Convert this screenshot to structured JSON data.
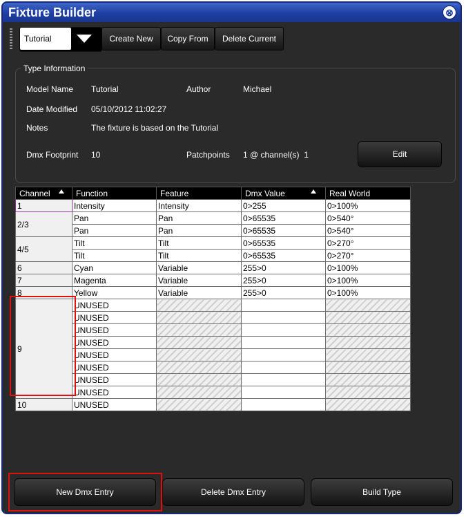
{
  "window": {
    "title": "Fixture Builder",
    "close_glyph": "⊗"
  },
  "toolbar": {
    "type_select_value": "Tutorial",
    "buttons": [
      "Create New",
      "Copy From",
      "Delete Current"
    ]
  },
  "type_info": {
    "legend": "Type Information",
    "model_name_label": "Model Name",
    "model_name": "Tutorial",
    "author_label": "Author",
    "author": "Michael",
    "date_label": "Date Modified",
    "date": "05/10/2012 11:02:27",
    "notes_label": "Notes",
    "notes": "The fixture is based on the Tutorial",
    "footprint_label": "Dmx Footprint",
    "footprint": "10",
    "patchpoints_label": "Patchpoints",
    "patchpoints": "1 @ channel(s)  1",
    "edit_label": "Edit"
  },
  "grid": {
    "headers": [
      "Channel",
      "Function",
      "Feature",
      "Dmx Value",
      "Real World"
    ],
    "rows": [
      {
        "channel": "1",
        "function": "Intensity",
        "feature": "Intensity",
        "dmx": "0>255",
        "real": "0>100%"
      },
      {
        "channel": "2/3",
        "function": "Pan",
        "feature": "Pan",
        "dmx": "0>65535",
        "real": "0>540°"
      },
      {
        "channel": "",
        "function": "Pan",
        "feature": "Pan",
        "dmx": "0>65535",
        "real": "0>540°"
      },
      {
        "channel": "4/5",
        "function": "Tilt",
        "feature": "Tilt",
        "dmx": "0>65535",
        "real": "0>270°"
      },
      {
        "channel": "",
        "function": "Tilt",
        "feature": "Tilt",
        "dmx": "0>65535",
        "real": "0>270°"
      },
      {
        "channel": "6",
        "function": "Cyan",
        "feature": "Variable",
        "dmx": "255>0",
        "real": "0>100%"
      },
      {
        "channel": "7",
        "function": "Magenta",
        "feature": "Variable",
        "dmx": "255>0",
        "real": "0>100%"
      },
      {
        "channel": "8",
        "function": "Yellow",
        "feature": "Variable",
        "dmx": "255>0",
        "real": "0>100%"
      },
      {
        "channel": "9",
        "function": "UNUSED",
        "feature": "",
        "dmx": "",
        "real": ""
      },
      {
        "channel": "",
        "function": "UNUSED",
        "feature": "",
        "dmx": "",
        "real": ""
      },
      {
        "channel": "",
        "function": "UNUSED",
        "feature": "",
        "dmx": "",
        "real": ""
      },
      {
        "channel": "",
        "function": "UNUSED",
        "feature": "",
        "dmx": "",
        "real": ""
      },
      {
        "channel": "",
        "function": "UNUSED",
        "feature": "",
        "dmx": "",
        "real": ""
      },
      {
        "channel": "",
        "function": "UNUSED",
        "feature": "",
        "dmx": "",
        "real": ""
      },
      {
        "channel": "",
        "function": "UNUSED",
        "feature": "",
        "dmx": "",
        "real": ""
      },
      {
        "channel": "",
        "function": "UNUSED",
        "feature": "",
        "dmx": "",
        "real": ""
      },
      {
        "channel": "10",
        "function": "UNUSED",
        "feature": "",
        "dmx": "",
        "real": ""
      }
    ]
  },
  "bottom": {
    "new_entry": "New Dmx Entry",
    "delete_entry": "Delete Dmx Entry",
    "build_type": "Build Type"
  },
  "colors": {
    "title_bar": "#1d3ea3",
    "window_bg": "#2a2a2a",
    "highlight": "#e01010"
  }
}
